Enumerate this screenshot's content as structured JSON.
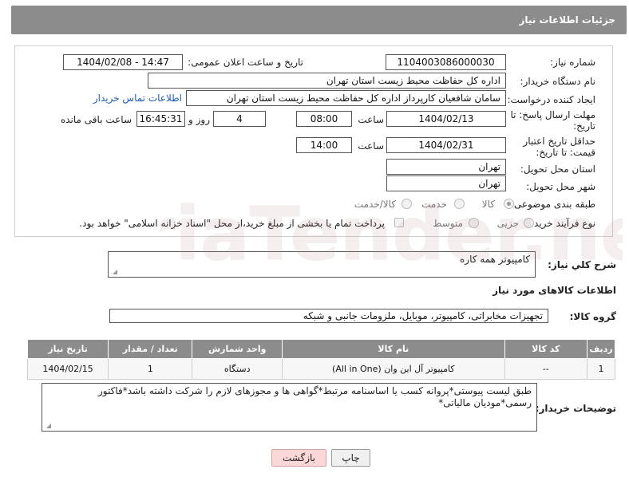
{
  "header": {
    "title": "جزئیات اطلاعات نیاز"
  },
  "form": {
    "need_number": {
      "label": "شماره نیاز:",
      "value": "1104003086000030"
    },
    "announce_datetime": {
      "label": "تاریخ و ساعت اعلان عمومی:",
      "value": "1404/02/08 - 14:47"
    },
    "buyer_org": {
      "label": "نام دستگاه خریدار:",
      "value": "اداره کل حفاظت محیط زیست استان تهران"
    },
    "requester": {
      "label": "ایجاد کننده درخواست:",
      "value": "سامان شافعیان کارپرداز اداره کل حفاظت محیط زیست استان تهران",
      "contact_link": "اطلاعات تماس خریدار"
    },
    "reply_deadline": {
      "label": "مهلت ارسال پاسخ: تا تاریخ:",
      "date": "1404/02/13",
      "time_label": "ساعت",
      "time": "08:00",
      "days": "4",
      "days_label": "روز و",
      "remaining": "16:45:31",
      "remaining_label": "ساعت باقی مانده"
    },
    "price_validity": {
      "label": "حداقل تاریخ اعتبار قیمت: تا تاریخ:",
      "date": "1404/02/31",
      "time_label": "ساعت",
      "time": "14:00"
    },
    "delivery_province": {
      "label": "استان محل تحویل:",
      "value": "تهران"
    },
    "delivery_city": {
      "label": "شهر محل تحویل:",
      "value": "تهران"
    },
    "category": {
      "label": "طبقه بندی موضوعی:",
      "options": [
        "کالا",
        "خدمت",
        "کالا/خدمت"
      ],
      "selected": "کالا"
    },
    "process_type": {
      "label": "نوع فرآیند خرید :",
      "options": [
        "جزیی",
        "متوسط"
      ],
      "selected": "",
      "note": "پرداخت تمام یا بخشی از مبلغ خرید،از محل \"اسناد خزانه اسلامی\" خواهد بود."
    }
  },
  "description": {
    "label": "شرح كلي نياز:",
    "value": "کامپیوتر همه کاره"
  },
  "goods_info": {
    "title": "اطلاعات کالاهای مورد نیاز",
    "group_label": "گروه کالا:",
    "group_value": "تجهیزات مخابراتی، کامپیوتر، موبایل، ملزومات جانبی و شبکه"
  },
  "table": {
    "headers": [
      "ردیف",
      "کد کالا",
      "نام کالا",
      "واحد شمارش",
      "تعداد / مقدار",
      "تاریخ نیاز"
    ],
    "rows": [
      [
        "1",
        "--",
        "کامپیوتر آل این وان (All in One)",
        "دستگاه",
        "1",
        "1404/02/15"
      ]
    ]
  },
  "buyer_notes": {
    "label": "توضیحات خریدار:",
    "line1": "طبق لیست پیوستی*پروانه کسب یا اساسنامه مرتبط*گواهی ها و مجوزهای لازم را شرکت داشته باشد*فاکتور",
    "line2": "رسمی*مودیان مالیاتی*"
  },
  "buttons": {
    "print": "چاپ",
    "back": "بازگشت"
  },
  "watermark": {
    "text": "AriaTender.neT"
  },
  "colors": {
    "header_bg": "#8c8c8c",
    "link": "#1a5fb4",
    "back_button": "#fbd7d7"
  }
}
